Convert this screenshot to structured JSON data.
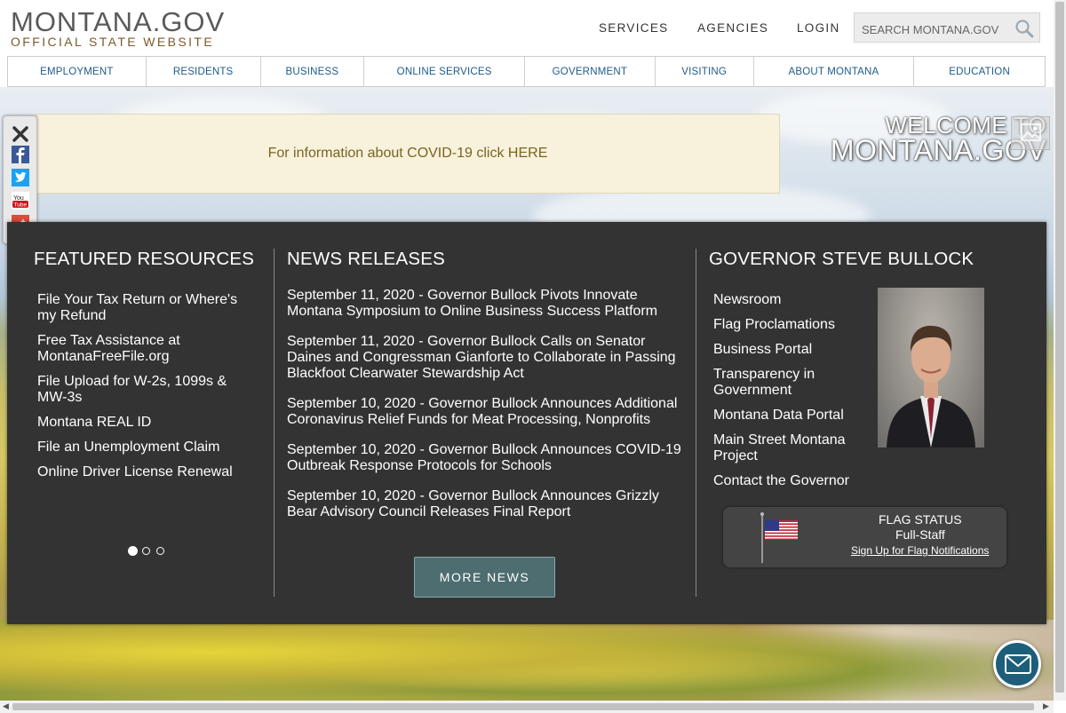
{
  "header": {
    "logo_main": "MONTANA.GOV",
    "logo_sub": "OFFICIAL STATE WEBSITE",
    "links": [
      "SERVICES",
      "AGENCIES",
      "LOGIN"
    ],
    "search_placeholder": "SEARCH MONTANA.GOV"
  },
  "nav": [
    "EMPLOYMENT",
    "RESIDENTS",
    "BUSINESS",
    "ONLINE SERVICES",
    "GOVERNMENT",
    "VISITING",
    "ABOUT MONTANA",
    "EDUCATION"
  ],
  "covid": {
    "text": "For information about COVID-19 click HERE"
  },
  "welcome": {
    "line1": "WELCOME TO",
    "line2": "MONTANA.GOV"
  },
  "social": [
    "close-icon",
    "facebook-icon",
    "twitter-icon",
    "youtube-icon",
    "google-plus-icon"
  ],
  "featured": {
    "title": "FEATURED RESOURCES",
    "items": [
      "File Your Tax Return or Where's my Refund",
      "Free Tax Assistance at MontanaFreeFile.org",
      "File Upload for W-2s, 1099s & MW-3s",
      "Montana REAL ID",
      "File an Unemployment Claim",
      "Online Driver License Renewal"
    ],
    "active_page": 1,
    "pages": 3
  },
  "news": {
    "title": "NEWS RELEASES",
    "items": [
      "September 11, 2020 - Governor Bullock Pivots Innovate Montana Symposium to Online Business Success Platform",
      "September 11, 2020 - Governor Bullock Calls on Senator Daines and Congressman Gianforte to Collaborate in Passing Blackfoot Clearwater Stewardship Act",
      "September 10, 2020 - Governor Bullock Announces Additional Coronavirus Relief Funds for Meat Processing, Nonprofits",
      "September 10, 2020 - Governor Bullock Announces COVID-19 Outbreak Response Protocols for Schools",
      "September 10, 2020 - Governor Bullock Announces Grizzly Bear Advisory Council Releases Final Report"
    ],
    "more_label": "MORE NEWS"
  },
  "governor": {
    "title": "GOVERNOR STEVE BULLOCK",
    "links": [
      "Newsroom",
      "Flag Proclamations",
      "Business Portal",
      "Transparency in Government",
      "Montana Data Portal",
      "Main Street Montana Project",
      "Contact the Governor"
    ]
  },
  "flag": {
    "title": "FLAG STATUS",
    "value": "Full-Staff",
    "signup": "Sign Up for Flag Notifications"
  },
  "colors": {
    "panel": "#333333",
    "nav_text": "#1f5a8a",
    "button": "#4d6d70",
    "chat": "#1d5e7a"
  }
}
